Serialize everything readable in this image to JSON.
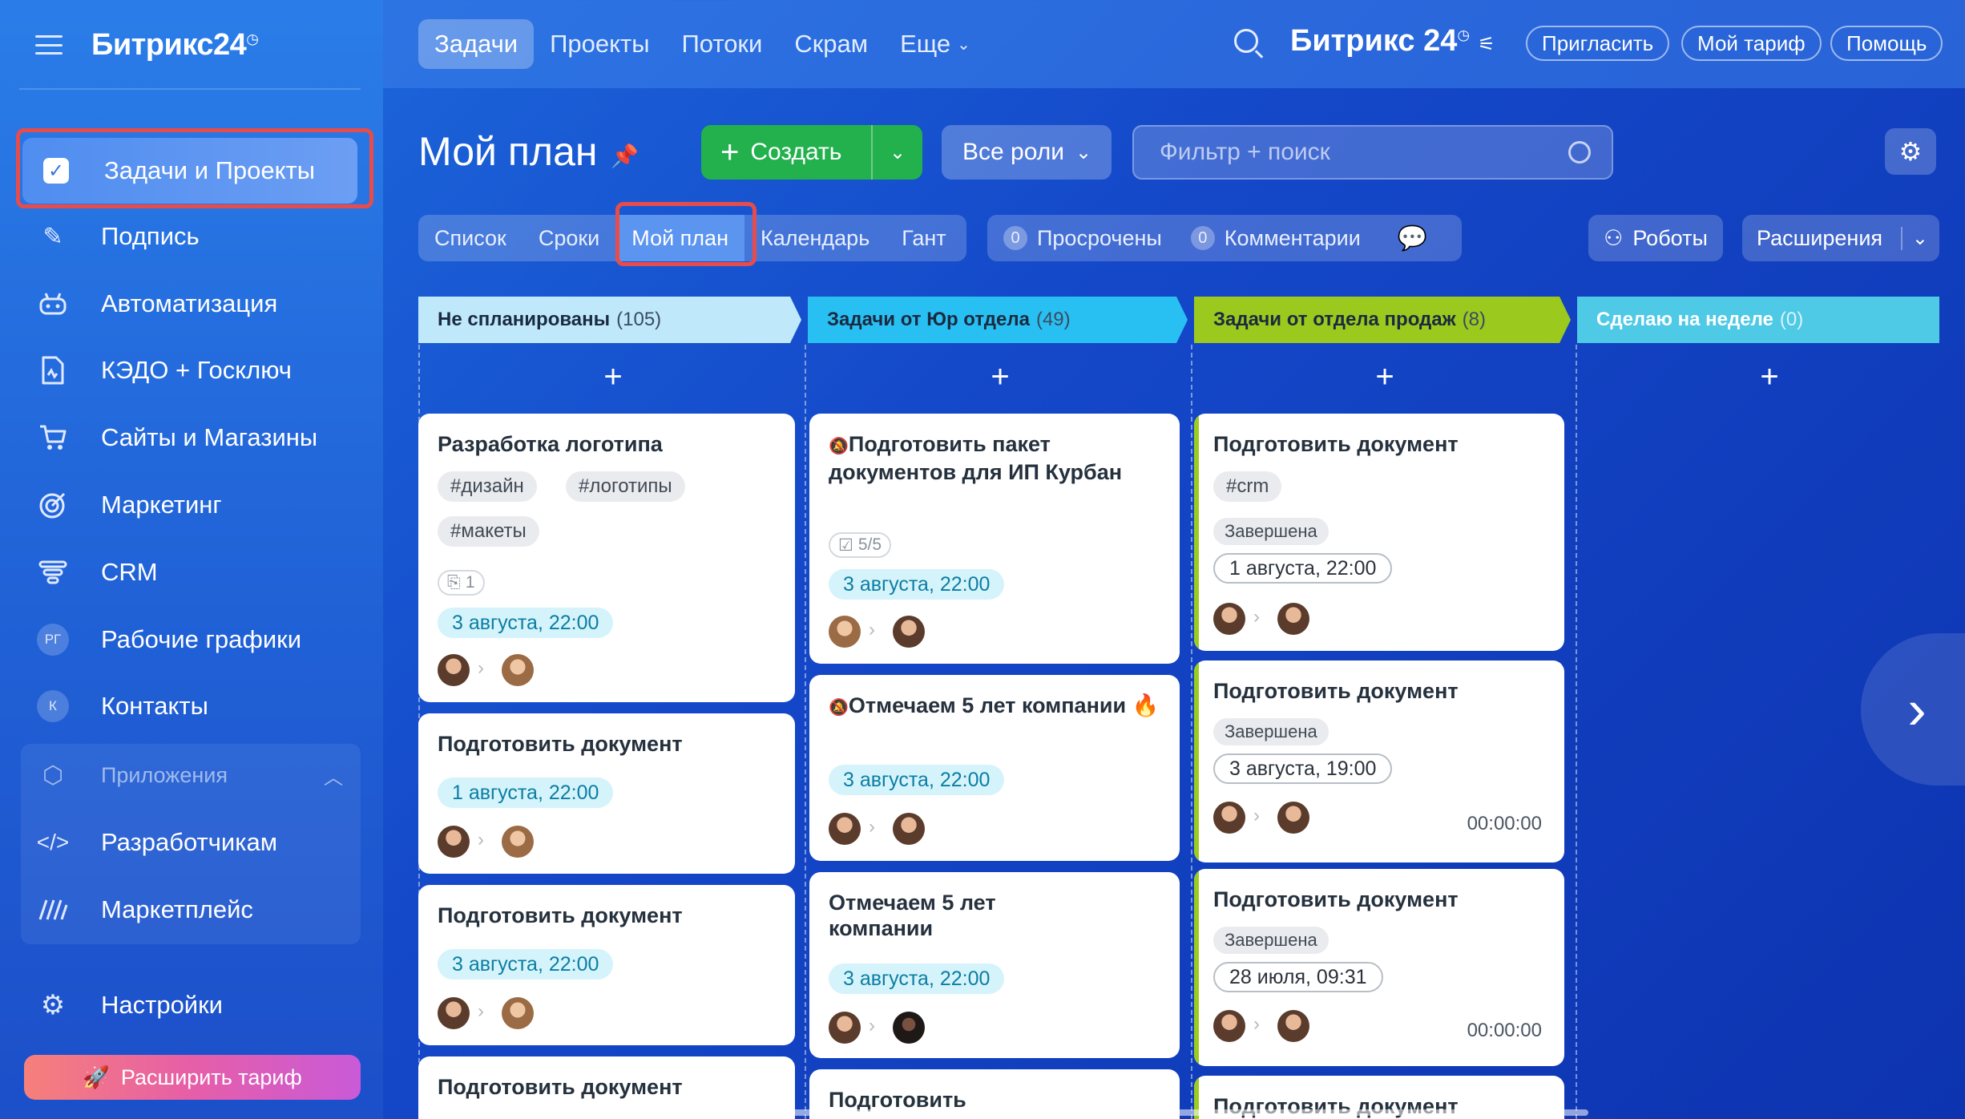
{
  "app": {
    "logo": "Битрикс24",
    "logo_mark": "◷"
  },
  "sidebar": {
    "items": [
      {
        "label": "Задачи и Проекты",
        "icon": "checkbox-icon"
      },
      {
        "label": "Подпись",
        "icon": "pen-icon"
      },
      {
        "label": "Автоматизация",
        "icon": "robot-icon"
      },
      {
        "label": "КЭДО + Госключ",
        "icon": "document-sign-icon"
      },
      {
        "label": "Сайты и Магазины",
        "icon": "cart-icon"
      },
      {
        "label": "Маркетинг",
        "icon": "target-icon"
      },
      {
        "label": "CRM",
        "icon": "funnel-icon"
      },
      {
        "label": "Рабочие графики",
        "icon": "avatar-initials",
        "initials": "РГ"
      },
      {
        "label": "Контакты",
        "icon": "avatar-initials",
        "initials": "К"
      }
    ],
    "apps_section": {
      "label": "Приложения",
      "items": [
        {
          "label": "Разработчикам",
          "icon": "code-icon"
        },
        {
          "label": "Маркетплейс",
          "icon": "marketplace-icon"
        }
      ]
    },
    "settings": "Настройки",
    "upgrade": "Расширить тариф"
  },
  "topbar": {
    "nav": [
      "Задачи",
      "Проекты",
      "Потоки",
      "Скрам",
      "Еще"
    ],
    "logo": "Битрикс 24",
    "buttons": [
      "Пригласить",
      "Мой тариф",
      "Помощь"
    ]
  },
  "page": {
    "title": "Мой план",
    "create": "Создать",
    "roles": "Все роли",
    "filter_placeholder": "Фильтр + поиск",
    "view_tabs": [
      "Список",
      "Сроки",
      "Мой план",
      "Календарь",
      "Гант"
    ],
    "active_tab": "Мой план",
    "counters": [
      {
        "count": "0",
        "label": "Просрочены"
      },
      {
        "count": "0",
        "label": "Комментарии"
      }
    ],
    "robots": "Роботы",
    "extensions": "Расширения"
  },
  "columns": [
    {
      "title": "Не спланированы",
      "count": "(105)",
      "color": "#bfe9fb"
    },
    {
      "title": "Задачи от Юр отдела",
      "count": "(49)",
      "color": "#28c0f3"
    },
    {
      "title": "Задачи от отдела продаж",
      "count": "(8)",
      "color": "#9bc91d"
    },
    {
      "title": "Сделаю на неделе",
      "count": "(0)",
      "color": "#4ec9e6"
    }
  ],
  "cards": {
    "c1": [
      {
        "title": "Разработка логотипа",
        "tags": [
          "#дизайн",
          "#логотипы",
          "#макеты"
        ],
        "attachments": "1",
        "date": "3 августа, 22:00"
      },
      {
        "title": "Подготовить документ",
        "date": "1 августа, 22:00"
      },
      {
        "title": "Подготовить документ",
        "date": "3 августа, 22:00"
      },
      {
        "title": "Подготовить документ"
      }
    ],
    "c2": [
      {
        "title": "Подготовить пакет документов для ИП Курбан",
        "checklist": "5/5",
        "date": "3 августа, 22:00"
      },
      {
        "title": "Отмечаем 5 лет компании",
        "date": "3 августа, 22:00"
      },
      {
        "title": "Отмечаем 5 лет компании",
        "date": "3 августа, 22:00"
      },
      {
        "title": "Подготовить"
      }
    ],
    "c3": [
      {
        "title": "Подготовить документ",
        "tags": [
          "#crm"
        ],
        "status": "Завершена",
        "date": "1 августа, 22:00"
      },
      {
        "title": "Подготовить документ",
        "status": "Завершена",
        "date": "3 августа, 19:00",
        "timer": "00:00:00"
      },
      {
        "title": "Подготовить документ",
        "status": "Завершена",
        "date": "28 июля, 09:31",
        "timer": "00:00:00"
      },
      {
        "title": "Подготовить документ"
      }
    ]
  }
}
